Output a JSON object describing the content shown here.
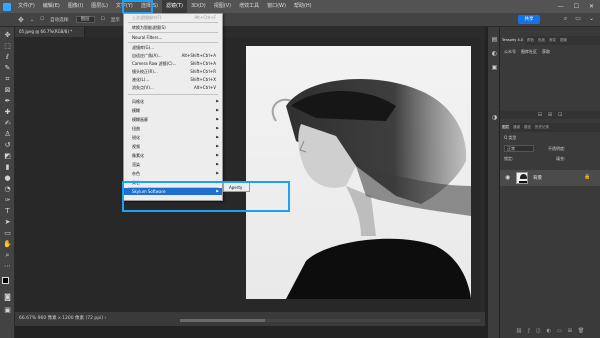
{
  "menubar": {
    "items": [
      "文件(F)",
      "编辑(E)",
      "图像(I)",
      "图层(L)",
      "文字(Y)",
      "选择(S)",
      "滤镜(T)",
      "3D(D)",
      "视图(V)",
      "增效工具",
      "窗口(W)",
      "帮助(H)"
    ],
    "active_index": 6,
    "minimize": "—",
    "maximize": "☐",
    "close": "✕"
  },
  "options_bar": {
    "auto_select_label": "自动选择:",
    "auto_select_value": "图层",
    "show_label": "显示",
    "share_label": "共享"
  },
  "document": {
    "tab_title": "05.jpeg @ 66.7%(RGB/8) *"
  },
  "status": {
    "text": "66.67%    960 像素 x 1200 像素 (72 ppi)    ›"
  },
  "filter_menu": {
    "items": [
      {
        "label": "上次滤镜操作(F)",
        "shortcut": "Alt+Ctrl+F",
        "disabled": true,
        "submenu": false
      },
      {
        "label": "转换为智能滤镜(S)",
        "shortcut": "",
        "disabled": false,
        "submenu": false
      },
      {
        "label": "Neural Filters...",
        "shortcut": "",
        "disabled": false,
        "submenu": false
      },
      {
        "label": "滤镜库(G)...",
        "shortcut": "",
        "disabled": false,
        "submenu": false
      },
      {
        "label": "自适应广角(A)...",
        "shortcut": "Alt+Shift+Ctrl+A",
        "disabled": false,
        "submenu": false
      },
      {
        "label": "Camera Raw 滤镜(C)...",
        "shortcut": "Shift+Ctrl+A",
        "disabled": false,
        "submenu": false
      },
      {
        "label": "镜头校正(R)...",
        "shortcut": "Shift+Ctrl+R",
        "disabled": false,
        "submenu": false
      },
      {
        "label": "液化(L)...",
        "shortcut": "Shift+Ctrl+X",
        "disabled": false,
        "submenu": false
      },
      {
        "label": "消失点(V)...",
        "shortcut": "Alt+Ctrl+V",
        "disabled": false,
        "submenu": false
      },
      {
        "label": "风格化",
        "shortcut": "",
        "disabled": false,
        "submenu": true
      },
      {
        "label": "模糊",
        "shortcut": "",
        "disabled": false,
        "submenu": true
      },
      {
        "label": "模糊画廊",
        "shortcut": "",
        "disabled": false,
        "submenu": true
      },
      {
        "label": "扭曲",
        "shortcut": "",
        "disabled": false,
        "submenu": true
      },
      {
        "label": "锐化",
        "shortcut": "",
        "disabled": false,
        "submenu": true
      },
      {
        "label": "视频",
        "shortcut": "",
        "disabled": false,
        "submenu": true
      },
      {
        "label": "像素化",
        "shortcut": "",
        "disabled": false,
        "submenu": true
      },
      {
        "label": "渲染",
        "shortcut": "",
        "disabled": false,
        "submenu": true
      },
      {
        "label": "杂色",
        "shortcut": "",
        "disabled": false,
        "submenu": true
      },
      {
        "label": "其它",
        "shortcut": "",
        "disabled": false,
        "submenu": true
      },
      {
        "label": "Skylum Software",
        "shortcut": "",
        "disabled": false,
        "submenu": true,
        "highlighted": true
      }
    ],
    "submenu_item": "Aperty"
  },
  "right_panel": {
    "plugin_tabs": [
      "Tensorly 4.0",
      "颜色",
      "色板",
      "渐变",
      "图案"
    ],
    "plugin_links": [
      "公众号",
      "图库社区",
      "获取"
    ],
    "layer_tabs": [
      "图层",
      "通道",
      "路径",
      "历史记录"
    ],
    "search_label": "Q 类型",
    "blend_mode": "正常",
    "opacity_label": "不透明度:",
    "lock_label": "锁定:",
    "fill_label": "填充:",
    "layer_name": "背景",
    "lock_icon": "🔒"
  },
  "colors": {
    "accent": "#1f6fd1",
    "highlight_box": "#1ea1f2"
  }
}
